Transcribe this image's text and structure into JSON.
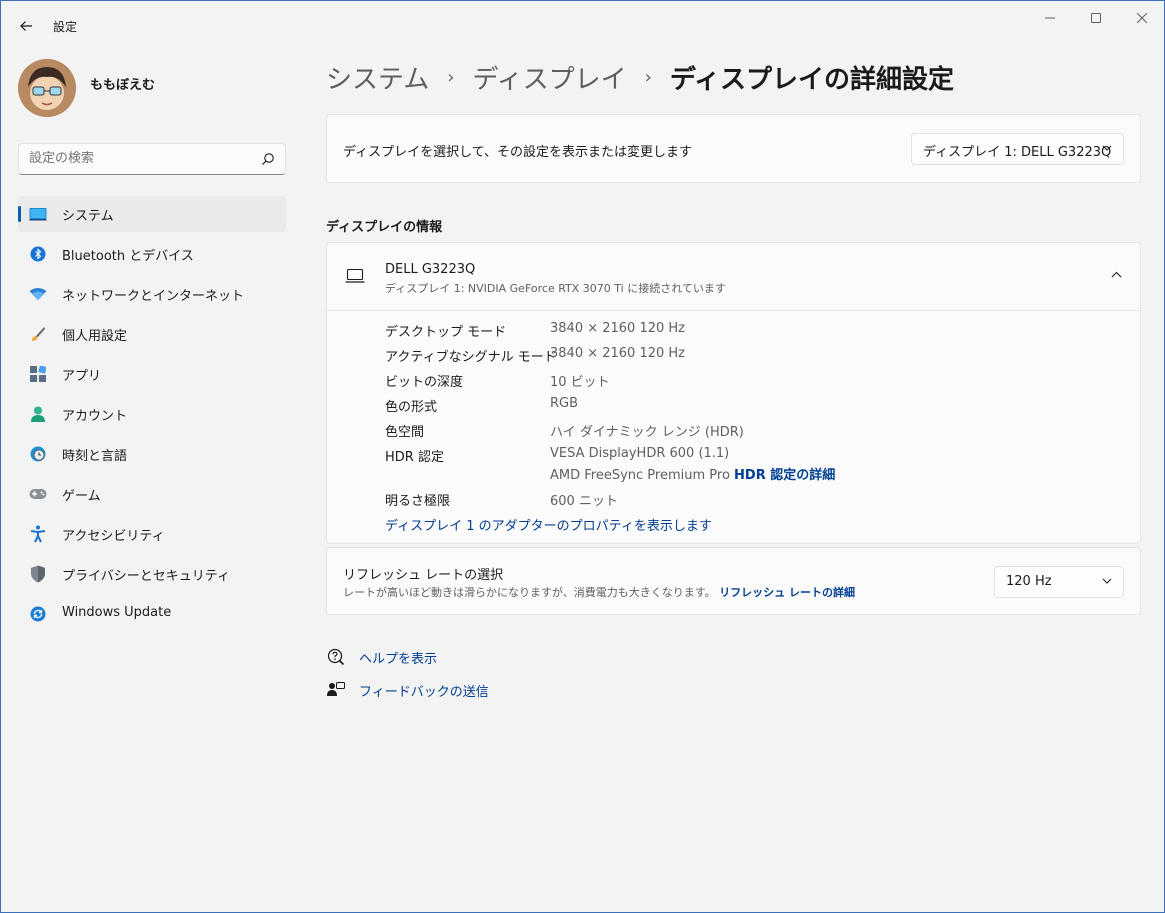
{
  "window": {
    "app_title": "設定"
  },
  "profile": {
    "user_name": "ももぼえむ"
  },
  "search": {
    "placeholder": "設定の検索"
  },
  "sidebar": {
    "items": [
      {
        "label": "システム",
        "icon": "system-icon",
        "active": true
      },
      {
        "label": "Bluetooth とデバイス",
        "icon": "bluetooth-icon"
      },
      {
        "label": "ネットワークとインターネット",
        "icon": "wifi-icon"
      },
      {
        "label": "個人用設定",
        "icon": "brush-icon"
      },
      {
        "label": "アプリ",
        "icon": "apps-icon"
      },
      {
        "label": "アカウント",
        "icon": "account-icon"
      },
      {
        "label": "時刻と言語",
        "icon": "clock-globe-icon"
      },
      {
        "label": "ゲーム",
        "icon": "gamepad-icon"
      },
      {
        "label": "アクセシビリティ",
        "icon": "accessibility-icon"
      },
      {
        "label": "プライバシーとセキュリティ",
        "icon": "shield-icon"
      },
      {
        "label": "Windows Update",
        "icon": "update-icon"
      }
    ]
  },
  "breadcrumb": {
    "level1": "システム",
    "level2": "ディスプレイ",
    "current": "ディスプレイの詳細設定",
    "separator": "›"
  },
  "display_select": {
    "label": "ディスプレイを選択して、その設定を表示または変更します",
    "selected": "ディスプレイ 1: DELL G3223Q"
  },
  "display_info": {
    "section_title": "ディスプレイの情報",
    "name": "DELL G3223Q",
    "subtitle": "ディスプレイ 1: NVIDIA GeForce RTX 3070 Ti に接続されています",
    "properties": {
      "desktop_mode_label": "デスクトップ モード",
      "desktop_mode_value": "3840 × 2160 120 Hz",
      "active_signal_label": "アクティブなシグナル モード",
      "active_signal_value": "3840 × 2160 120 Hz",
      "bit_depth_label": "ビットの深度",
      "bit_depth_value": "10 ビット",
      "color_format_label": "色の形式",
      "color_format_value": "RGB",
      "color_space_label": "色空間",
      "color_space_value": "ハイ ダイナミック レンジ (HDR)",
      "hdr_cert_label": "HDR 認定",
      "hdr_cert_value1": "VESA DisplayHDR 600 (1.1)",
      "hdr_cert_value2": "AMD FreeSync Premium Pro",
      "hdr_cert_link": "HDR 認定の詳細",
      "brightness_label": "明るさ極限",
      "brightness_value": "600 ニット"
    },
    "adapter_link": "ディスプレイ 1 のアダプターのプロパティを表示します"
  },
  "refresh": {
    "title": "リフレッシュ レートの選択",
    "subtitle": "レートが高いほど動きは滑らかになりますが、消費電力も大きくなります。",
    "link": "リフレッシュ レートの詳細",
    "selected": "120 Hz"
  },
  "help": {
    "help_label": "ヘルプを表示",
    "feedback_label": "フィードバックの送信"
  },
  "colors": {
    "accent": "#005fb8",
    "link": "#003e92",
    "background": "#f3f3f3",
    "card": "#fbfbfb"
  }
}
